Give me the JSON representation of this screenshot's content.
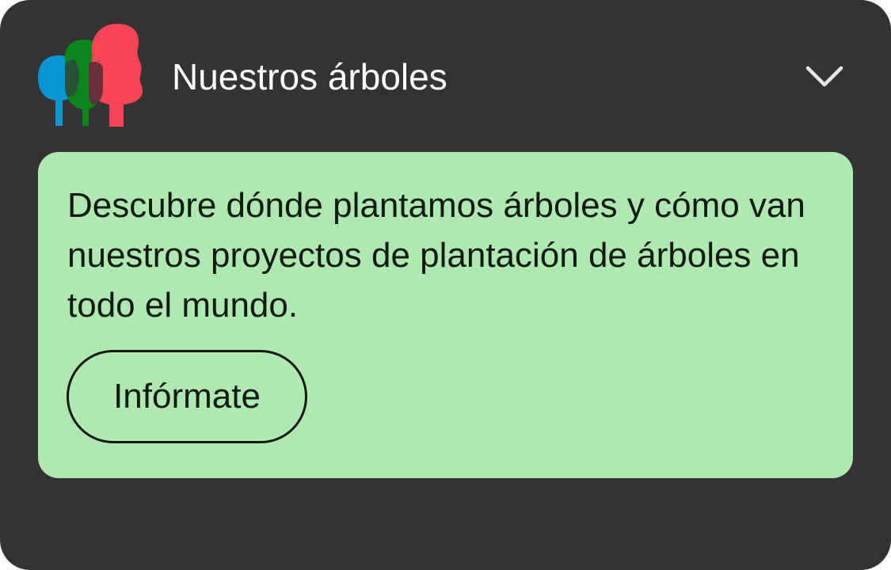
{
  "widget": {
    "title": "Nuestros árboles",
    "logo_icon": "trees-logo-icon",
    "toggle_icon": "chevron-down-icon",
    "description": "Descubre dónde plantamos árboles y cómo van nuestros proyectos de plantación de árboles en todo el mundo.",
    "cta_label": "Infórmate"
  },
  "colors": {
    "card_background": "#333333",
    "panel_background": "#b0e8b2",
    "text_light": "#ffffff",
    "text_dark": "#0f1a10",
    "tree_blue": "#0a96d2",
    "tree_green": "#0c8a1c",
    "tree_red": "#ff4557"
  }
}
